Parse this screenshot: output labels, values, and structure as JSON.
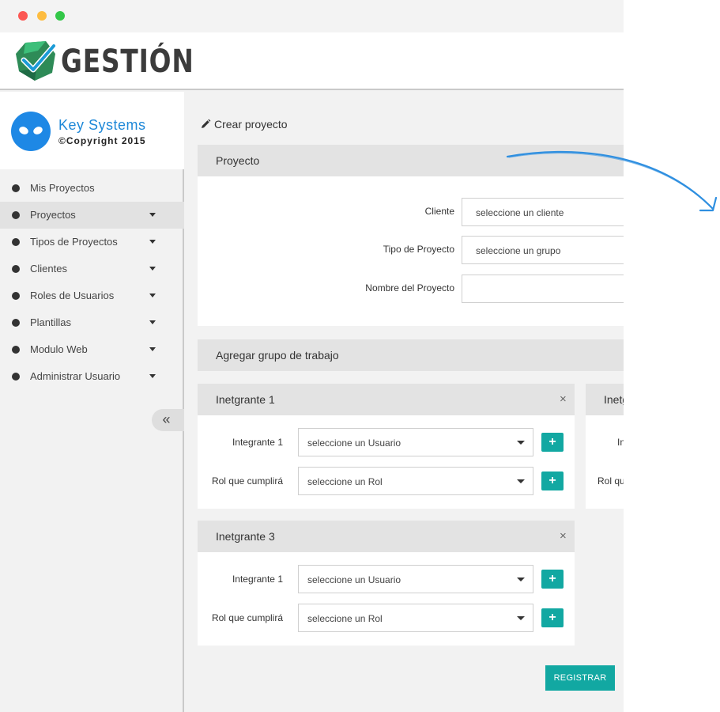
{
  "app": {
    "logo_text": "GESTIÓN",
    "accent_color": "#12a8a2"
  },
  "brand": {
    "name": "Key Systems",
    "copyright": "©Copyright 2015"
  },
  "sidebar": {
    "items": [
      {
        "label": "Mis Proyectos",
        "has_caret": false,
        "active": false
      },
      {
        "label": "Proyectos",
        "has_caret": true,
        "active": true
      },
      {
        "label": "Tipos de Proyectos",
        "has_caret": true,
        "active": false
      },
      {
        "label": "Clientes",
        "has_caret": true,
        "active": false
      },
      {
        "label": "Roles de Usuarios",
        "has_caret": true,
        "active": false
      },
      {
        "label": "Plantillas",
        "has_caret": true,
        "active": false
      },
      {
        "label": "Modulo Web",
        "has_caret": true,
        "active": false
      },
      {
        "label": "Administrar Usuario",
        "has_caret": true,
        "active": false
      }
    ],
    "collapse_glyph": "«"
  },
  "page": {
    "title": "Crear proyecto"
  },
  "proyecto": {
    "section_title": "Proyecto",
    "cliente_label": "Cliente",
    "cliente_value": "seleccione un cliente",
    "tipo_label": "Tipo de Proyecto",
    "tipo_value": "seleccione un grupo",
    "nombre_label": "Nombre del Proyecto",
    "nombre_value": ""
  },
  "grupo": {
    "section_title": "Agregar grupo de trabajo",
    "cards": [
      {
        "title": "Inetgrante 1",
        "close": "×",
        "integrante_label": "Integrante 1",
        "integrante_value": "seleccione un Usuario",
        "rol_label": "Rol que cumplirá",
        "rol_value": "seleccione un Rol",
        "plus": "+"
      },
      {
        "title": "Inetg",
        "integrante_label": "In",
        "rol_label": "Rol qu"
      },
      {
        "title": "Inetgrante 3",
        "close": "×",
        "integrante_label": "Integrante 1",
        "integrante_value": "seleccione un Usuario",
        "rol_label": "Rol que cumplirá",
        "rol_value": "seleccione un Rol",
        "plus": "+"
      }
    ]
  },
  "actions": {
    "register_label": "REGISTRAR"
  }
}
